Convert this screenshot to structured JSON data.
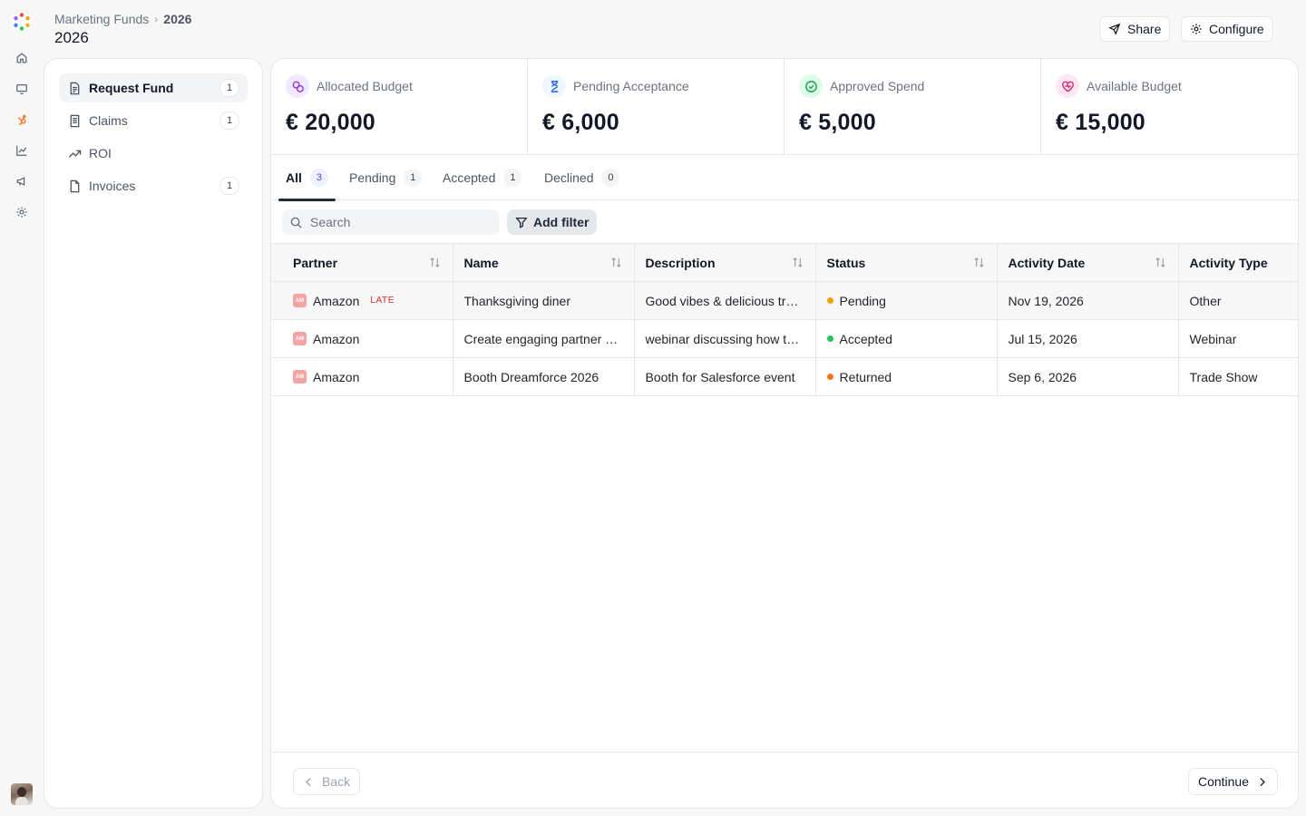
{
  "breadcrumb": {
    "parent": "Marketing Funds",
    "separator": "›",
    "current": "2026"
  },
  "page_title": "2026",
  "header_actions": {
    "share": "Share",
    "configure": "Configure"
  },
  "rail_icons": [
    "home-icon",
    "monitor-icon",
    "hubspot-icon",
    "chart-icon",
    "megaphone-icon",
    "settings-icon"
  ],
  "menu": [
    {
      "label": "Request Fund",
      "count": "1",
      "icon": "document-icon"
    },
    {
      "label": "Claims",
      "count": "1",
      "icon": "receipt-icon"
    },
    {
      "label": "ROI",
      "count": "",
      "icon": "trend-up-icon"
    },
    {
      "label": "Invoices",
      "count": "1",
      "icon": "file-icon"
    }
  ],
  "stats": [
    {
      "label": "Allocated Budget",
      "value": "€ 20,000",
      "color": "#9333ea",
      "bg": "#f3e8ff"
    },
    {
      "label": "Pending Acceptance",
      "value": "€ 6,000",
      "color": "#2563eb",
      "bg": "#eff6ff"
    },
    {
      "label": "Approved Spend",
      "value": "€ 5,000",
      "color": "#16a34a",
      "bg": "#dcfce7"
    },
    {
      "label": "Available Budget",
      "value": "€ 15,000",
      "color": "#db2777",
      "bg": "#fce7f3"
    }
  ],
  "tabs": [
    {
      "label": "All",
      "count": "3"
    },
    {
      "label": "Pending",
      "count": "1"
    },
    {
      "label": "Accepted",
      "count": "1"
    },
    {
      "label": "Declined",
      "count": "0"
    }
  ],
  "search": {
    "placeholder": "Search"
  },
  "filter": {
    "label": "Add filter"
  },
  "table": {
    "columns": [
      "Partner",
      "Name",
      "Description",
      "Status",
      "Activity Date",
      "Activity Type"
    ],
    "rows": [
      {
        "partner": "Amazon",
        "late": "LATE",
        "name": "Thanksgiving diner",
        "description": "Good vibes & delicious treats",
        "status": "Pending",
        "status_color": "#f59e0b",
        "date": "Nov 19, 2026",
        "type": "Other"
      },
      {
        "partner": "Amazon",
        "late": "",
        "name": "Create engaging partner content",
        "description": "webinar discussing how to grow",
        "status": "Accepted",
        "status_color": "#22c55e",
        "date": "Jul 15, 2026",
        "type": "Webinar"
      },
      {
        "partner": "Amazon",
        "late": "",
        "name": "Booth Dreamforce 2026",
        "description": "Booth for Salesforce event",
        "status": "Returned",
        "status_color": "#f97316",
        "date": "Sep 6, 2026",
        "type": "Trade Show"
      }
    ]
  },
  "footer": {
    "back": "Back",
    "continue": "Continue"
  }
}
